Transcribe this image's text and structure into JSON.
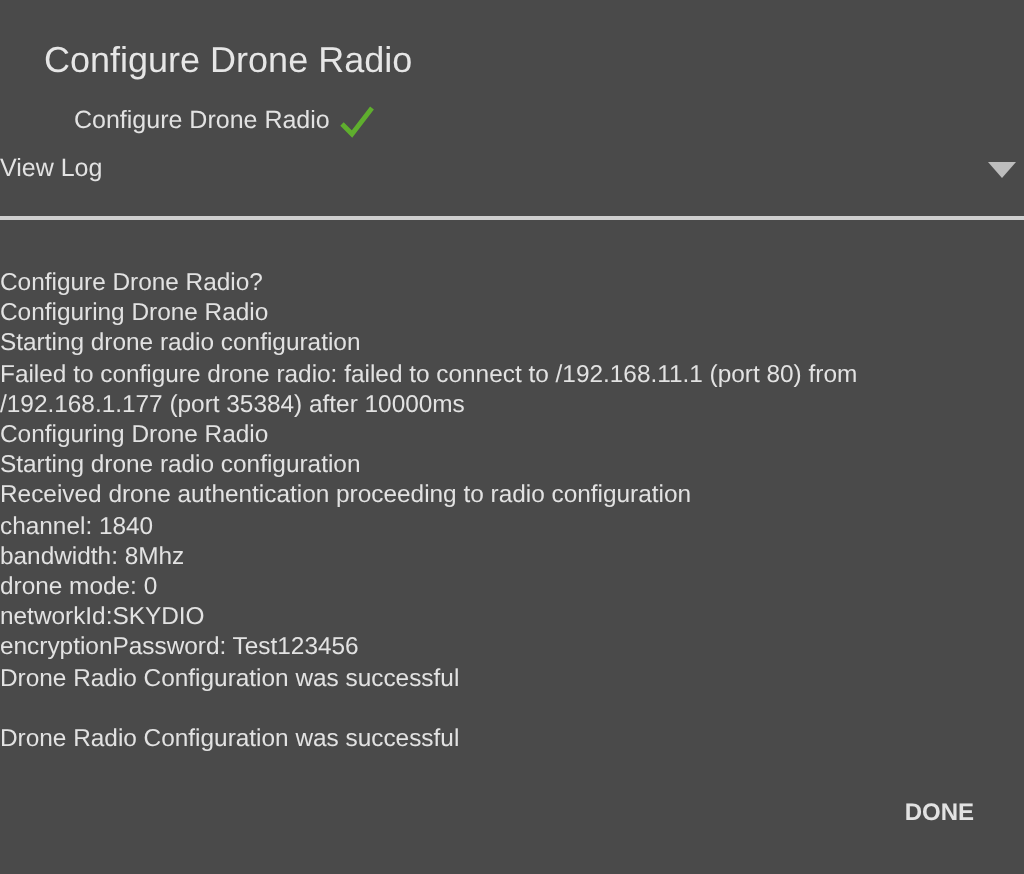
{
  "dialog": {
    "title": "Configure Drone Radio"
  },
  "status": {
    "label": "Configure Drone Radio",
    "done": true
  },
  "dropdown": {
    "label": "View Log",
    "expanded": true
  },
  "log": [
    "Configure Drone Radio?",
    "Configuring Drone Radio",
    "Starting drone radio configuration",
    "Failed to configure drone radio: failed to connect to /192.168.11.1 (port 80) from /192.168.1.177 (port 35384) after 10000ms",
    "Configuring Drone Radio",
    "Starting drone radio configuration",
    "Received drone authentication proceeding to radio configuration",
    "channel: 1840",
    "bandwidth: 8Mhz",
    "drone mode: 0",
    "networkId:SKYDIO",
    "encryptionPassword: Test123456",
    "Drone Radio Configuration was successful"
  ],
  "result": "Drone Radio Configuration was successful",
  "buttons": [
    "DONE"
  ]
}
